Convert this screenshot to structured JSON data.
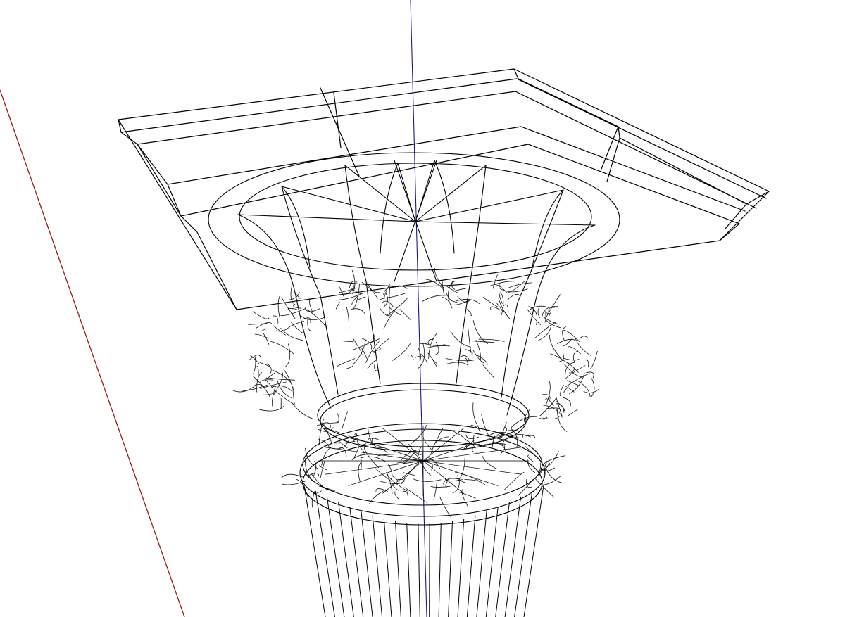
{
  "scene": {
    "background": "#ffffff",
    "style": "wireframe",
    "subject": "corinthian-capital-model"
  },
  "axes": {
    "red_axis_color": "#a01818",
    "blue_axis_color": "#1a1a8c"
  },
  "colors": {
    "edge": "#000000",
    "foliage": "#111111"
  }
}
